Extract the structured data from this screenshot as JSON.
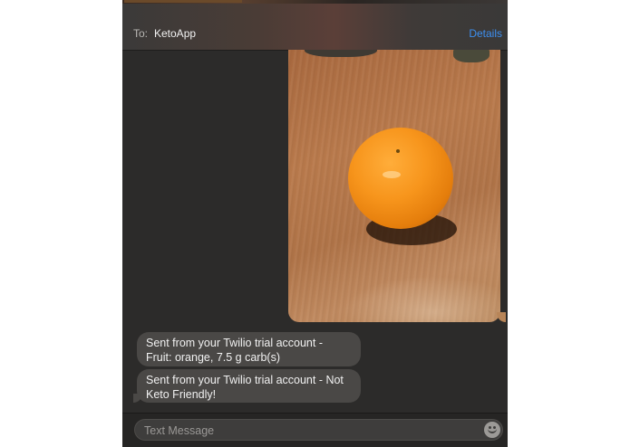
{
  "header": {
    "to_label": "To:",
    "recipient": "KetoApp",
    "details_label": "Details"
  },
  "thread": {
    "attachment": {
      "type": "photo",
      "subject": "orange"
    },
    "messages": [
      {
        "line1": "Sent from your Twilio trial account -",
        "line2": "Fruit: orange, 7.5 g carb(s)"
      },
      {
        "line1": "Sent from your Twilio trial account - Not",
        "line2": "Keto Friendly!"
      }
    ]
  },
  "composer": {
    "placeholder": "Text Message",
    "emoji_icon": "emoji-icon"
  },
  "colors": {
    "background": "#2c2b2a",
    "incoming_bubble": "#4a4846",
    "link_blue": "#3d8ff0"
  }
}
